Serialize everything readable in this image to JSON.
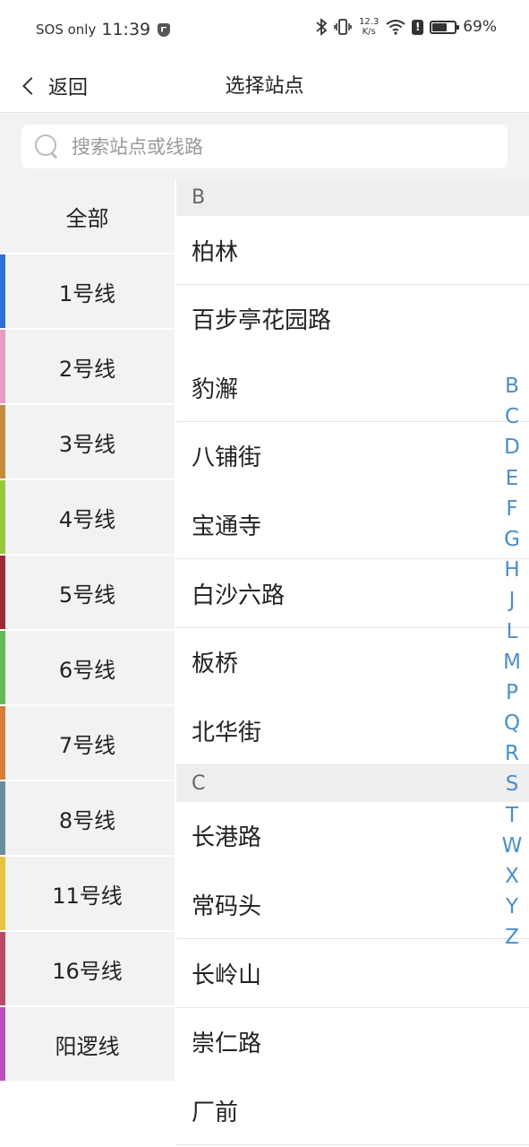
{
  "status_bar": {
    "carrier": "SOS only",
    "time": "11:39",
    "speed_value": "12.3",
    "speed_unit": "K/s",
    "battery": "69%"
  },
  "nav": {
    "back_label": "返回",
    "title": "选择站点"
  },
  "search": {
    "placeholder": "搜索站点或线路"
  },
  "lines": [
    {
      "label": "全部",
      "color": ""
    },
    {
      "label": "1号线",
      "color": "#2f6fd2"
    },
    {
      "label": "2号线",
      "color": "#e79ac6"
    },
    {
      "label": "3号线",
      "color": "#c58a3a"
    },
    {
      "label": "4号线",
      "color": "#9ac63a"
    },
    {
      "label": "5号线",
      "color": "#9a2d39"
    },
    {
      "label": "6号线",
      "color": "#63bb57"
    },
    {
      "label": "7号线",
      "color": "#d67d3a"
    },
    {
      "label": "8号线",
      "color": "#6a8ea0"
    },
    {
      "label": "11号线",
      "color": "#e8c340"
    },
    {
      "label": "16号线",
      "color": "#bb4a67"
    },
    {
      "label": "阳逻线",
      "color": "#b94fbf"
    }
  ],
  "station_groups": [
    {
      "letter": "B",
      "stations": [
        "柏林",
        "百步亭花园路",
        "豹澥",
        "八铺街",
        "宝通寺",
        "白沙六路",
        "板桥",
        "北华街"
      ]
    },
    {
      "letter": "C",
      "stations": [
        "长港路",
        "常码头",
        "长岭山",
        "崇仁路",
        "厂前"
      ]
    }
  ],
  "index_letters": [
    "B",
    "C",
    "D",
    "E",
    "F",
    "G",
    "H",
    "J",
    "L",
    "M",
    "P",
    "Q",
    "R",
    "S",
    "T",
    "W",
    "X",
    "Y",
    "Z"
  ]
}
